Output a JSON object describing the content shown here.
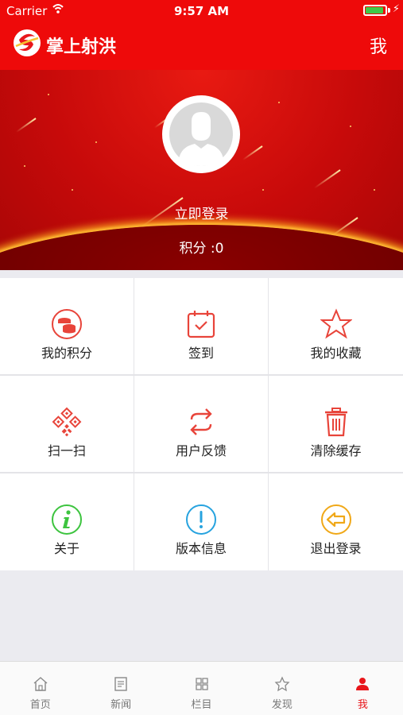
{
  "status_bar": {
    "carrier": "Carrier",
    "time": "9:57 AM"
  },
  "header": {
    "app_title": "掌上射洪",
    "right_label": "我"
  },
  "profile": {
    "login_label": "立即登录",
    "points_text": "积分 :0"
  },
  "menu": [
    {
      "label": "我的积分",
      "icon": "coins-icon"
    },
    {
      "label": "签到",
      "icon": "calendar-check-icon"
    },
    {
      "label": "我的收藏",
      "icon": "star-icon"
    },
    {
      "label": "扫一扫",
      "icon": "qr-code-icon"
    },
    {
      "label": "用户反馈",
      "icon": "feedback-arrows-icon"
    },
    {
      "label": "清除缓存",
      "icon": "trash-icon"
    },
    {
      "label": "关于",
      "icon": "info-icon"
    },
    {
      "label": "版本信息",
      "icon": "exclamation-icon"
    },
    {
      "label": "退出登录",
      "icon": "logout-arrow-icon"
    }
  ],
  "tabs": [
    {
      "label": "首页",
      "icon": "home-icon",
      "active": false
    },
    {
      "label": "新闻",
      "icon": "news-icon",
      "active": false
    },
    {
      "label": "栏目",
      "icon": "grid-icon",
      "active": false
    },
    {
      "label": "发现",
      "icon": "discover-star-icon",
      "active": false
    },
    {
      "label": "我",
      "icon": "person-icon",
      "active": true
    }
  ],
  "colors": {
    "brand": "#ee0a0a",
    "active_tab": "#e8161b",
    "grid_line": "#e4e4e8"
  }
}
